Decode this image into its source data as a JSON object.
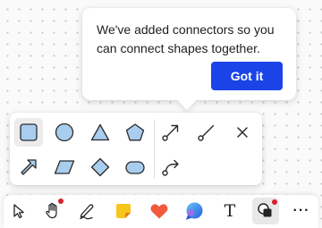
{
  "tooltip": {
    "message": "We've added connectors so you can connect shapes together.",
    "button_label": "Got it",
    "button_color": "#1a44e8"
  },
  "shape_picker": {
    "shapes": [
      "rectangle-icon",
      "circle-icon",
      "triangle-icon",
      "pentagon-icon",
      "arrow-icon",
      "parallelogram-icon",
      "diamond-icon",
      "rounded-rectangle-icon"
    ],
    "selected": "rectangle-icon",
    "shape_fill": "#a9cdee",
    "connectors": [
      "straight-connector-icon",
      "line-connector-icon",
      "curved-connector-icon"
    ],
    "close": "close-icon"
  },
  "toolbar": {
    "tools": [
      "select-icon",
      "hand-icon",
      "pen-icon",
      "sticky-note-icon",
      "reaction-icon",
      "comment-icon",
      "text-icon",
      "shapes-icon",
      "more-icon"
    ],
    "text_tool_glyph": "T",
    "more_glyph": "···",
    "notification_color": "#d5202a"
  }
}
